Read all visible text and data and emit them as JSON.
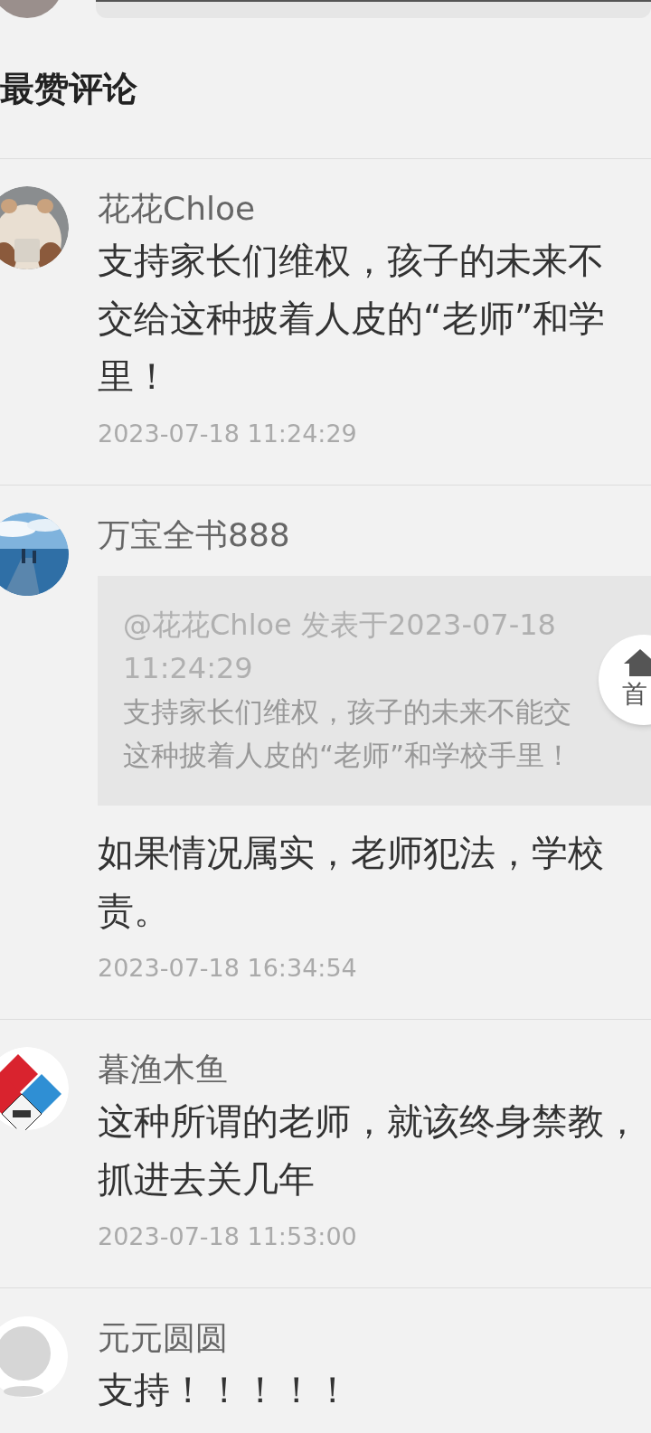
{
  "section_title": "最赞评论",
  "comments": [
    {
      "author": "花花Chloe",
      "avatar": {
        "kind": "picture"
      },
      "lines": [
        "支持家长们维权，孩子的未来不",
        "交给这种披着人皮的“老师”和学",
        "里！"
      ],
      "time": "2023-07-18 11:24:29"
    },
    {
      "author": "万宝全书888",
      "avatar": {
        "kind": "picture"
      },
      "quote": {
        "header_lines": [
          "@花花Chloe 发表于2023-07-18",
          "11:24:29"
        ],
        "lines": [
          "支持家长们维权，孩子的未来不能交",
          "这种披着人皮的“老师”和学校手里！"
        ]
      },
      "lines": [
        "如果情况属实，老师犯法，学校",
        "责。"
      ],
      "time": "2023-07-18 16:34:54"
    },
    {
      "author": "暮渔木鱼",
      "avatar": {
        "kind": "picture"
      },
      "lines": [
        "这种所谓的老师，就该终身禁教，",
        "抓进去关几年"
      ],
      "time": "2023-07-18 11:53:00"
    },
    {
      "author": "元元圆圆",
      "avatar": {
        "kind": "default"
      },
      "lines": [
        "支持！！！！！"
      ]
    }
  ],
  "home_button": {
    "label": "首"
  }
}
